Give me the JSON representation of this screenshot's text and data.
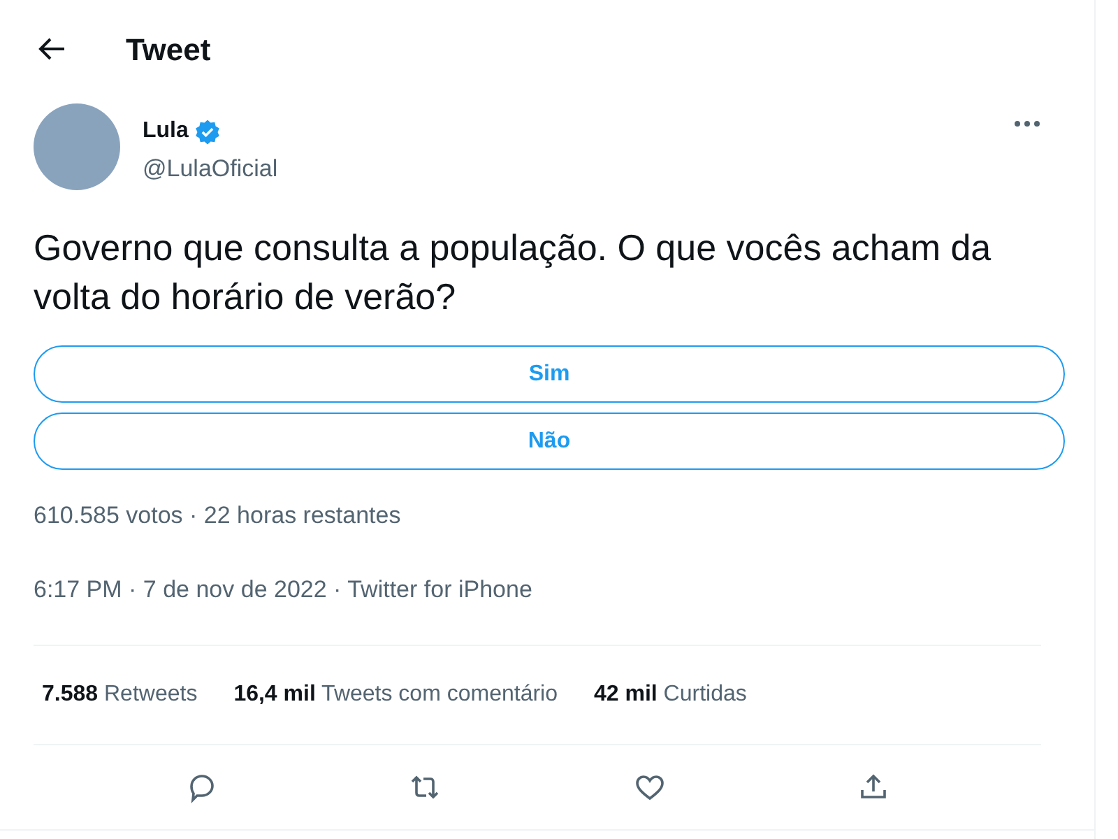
{
  "header": {
    "title": "Tweet"
  },
  "author": {
    "name": "Lula",
    "verified": true,
    "handle": "@LulaOficial"
  },
  "text": "Governo que consulta a população. O que vocês acham da volta do horário de verão?",
  "poll": {
    "options": [
      {
        "label": "Sim"
      },
      {
        "label": "Não"
      }
    ],
    "summary": "610.585 votos · 22 horas restantes"
  },
  "timestamp": "6:17 PM · 7 de nov de 2022 · Twitter for iPhone",
  "stats": [
    {
      "count": "7.588",
      "label": "Retweets"
    },
    {
      "count": "16,4 mil",
      "label": "Tweets com comentário"
    },
    {
      "count": "42 mil",
      "label": "Curtidas"
    }
  ],
  "actions": [
    {
      "kind": "reply"
    },
    {
      "kind": "retweet"
    },
    {
      "kind": "like"
    },
    {
      "kind": "share"
    }
  ]
}
